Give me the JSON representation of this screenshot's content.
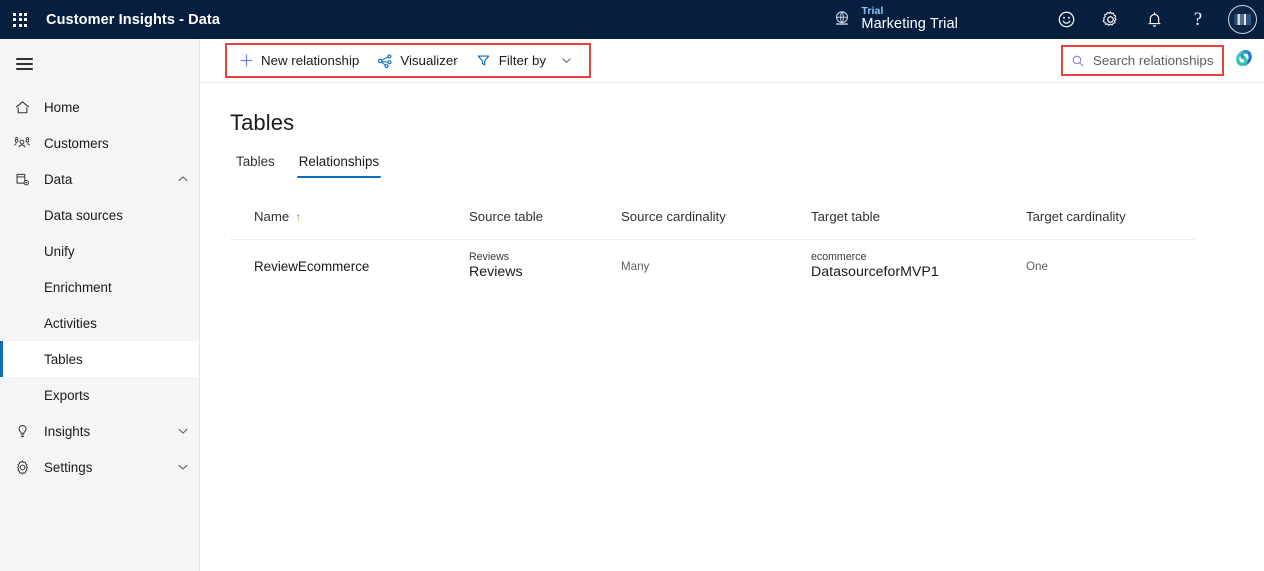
{
  "header": {
    "waffle_icon": "app-launcher-icon",
    "app_title": "Customer Insights - Data",
    "environment": {
      "icon": "globe-icon",
      "trial_label": "Trial",
      "name": "Marketing Trial"
    },
    "actions": [
      {
        "name": "feedback-icon",
        "label": "Feedback"
      },
      {
        "name": "settings-gear-icon",
        "label": "Settings"
      },
      {
        "name": "notifications-bell-icon",
        "label": "Notifications"
      },
      {
        "name": "help-question-icon",
        "label": "?"
      }
    ],
    "avatar_label": "Account manager"
  },
  "commandbar": {
    "new_relationship": {
      "label": "New relationship",
      "icon": "plus-icon"
    },
    "visualizer": {
      "label": "Visualizer",
      "icon": "share-graph-icon"
    },
    "filter_by": {
      "label": "Filter by",
      "icon": "filter-funnel-icon",
      "chevron": "chevron-down-icon"
    },
    "search": {
      "placeholder": "Search relationships",
      "icon": "search-icon"
    },
    "copilot": {
      "label": "Copilot",
      "icon": "copilot-icon"
    },
    "highlight_color": "#E8403A"
  },
  "sidebar": {
    "menu_toggle": "hamburger-icon",
    "items": [
      {
        "label": "Home",
        "icon": "home-icon",
        "level": "top",
        "selected": false,
        "expandable": false
      },
      {
        "label": "Customers",
        "icon": "customers-icon",
        "level": "top",
        "selected": false,
        "expandable": false
      },
      {
        "label": "Data",
        "icon": "data-icon",
        "level": "top",
        "selected": false,
        "expandable": true,
        "expanded": true
      },
      {
        "label": "Data sources",
        "icon": "",
        "level": "sub",
        "selected": false,
        "expandable": false
      },
      {
        "label": "Unify",
        "icon": "",
        "level": "sub",
        "selected": false,
        "expandable": false
      },
      {
        "label": "Enrichment",
        "icon": "",
        "level": "sub",
        "selected": false,
        "expandable": false
      },
      {
        "label": "Activities",
        "icon": "",
        "level": "sub",
        "selected": false,
        "expandable": false
      },
      {
        "label": "Tables",
        "icon": "",
        "level": "sub",
        "selected": true,
        "expandable": false
      },
      {
        "label": "Exports",
        "icon": "",
        "level": "sub",
        "selected": false,
        "expandable": false
      },
      {
        "label": "Insights",
        "icon": "lightbulb-icon",
        "level": "top",
        "selected": false,
        "expandable": true,
        "expanded": false
      },
      {
        "label": "Settings",
        "icon": "gear-icon",
        "level": "top",
        "selected": false,
        "expandable": true,
        "expanded": false
      }
    ],
    "accent_color": "#0f6cbd"
  },
  "main": {
    "page_title": "Tables",
    "tabs": [
      {
        "label": "Tables",
        "active": false
      },
      {
        "label": "Relationships",
        "active": true
      }
    ],
    "table": {
      "columns": [
        {
          "label": "Name",
          "sort": "↑"
        },
        {
          "label": "Source table",
          "sort": ""
        },
        {
          "label": "Source cardinality",
          "sort": ""
        },
        {
          "label": "Target table",
          "sort": ""
        },
        {
          "label": "Target cardinality",
          "sort": ""
        }
      ],
      "rows": [
        {
          "name": "ReviewEcommerce",
          "source_table_sub": "Reviews",
          "source_table": "Reviews",
          "source_cardinality": "Many",
          "target_table_sub": "ecommerce",
          "target_table": "DatasourceforMVP1",
          "target_cardinality": "One"
        }
      ]
    }
  }
}
